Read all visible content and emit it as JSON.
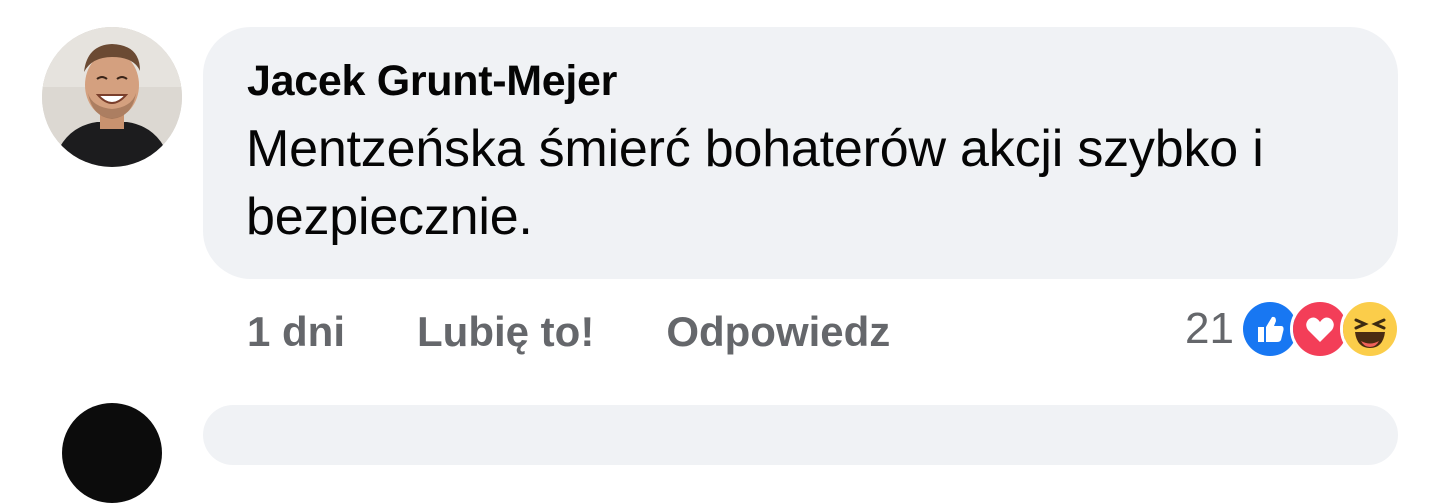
{
  "comment": {
    "author": "Jacek Grunt-Mejer",
    "text": "Mentzeńska śmierć bohaterów akcji szybko i bezpiecznie.",
    "avatar_icon": "user-avatar-photo"
  },
  "actions": {
    "time": "1 dni",
    "like_label": "Lubię to!",
    "reply_label": "Odpowiedz"
  },
  "reactions": {
    "count": "21",
    "icons": [
      "like-icon",
      "love-icon",
      "haha-icon"
    ]
  },
  "colors": {
    "bubble": "#f0f2f5",
    "action_text": "#65676b",
    "like_blue": "#1877f2",
    "love_red": "#f33e58",
    "haha_yellow": "#fbcd4a"
  }
}
